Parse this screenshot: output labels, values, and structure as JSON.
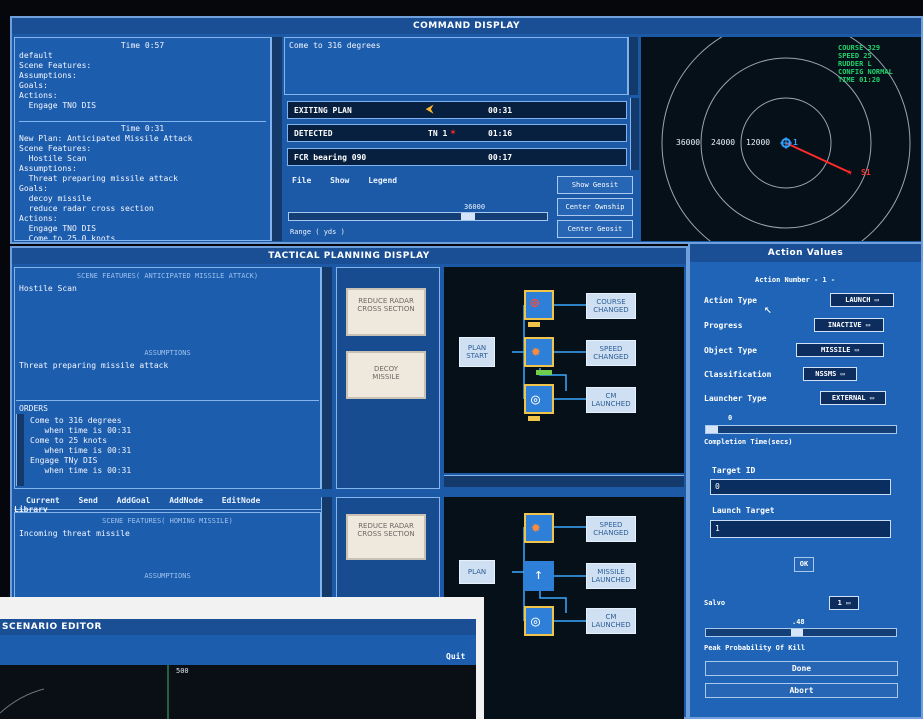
{
  "command_display": {
    "title": "COMMAND DISPLAY",
    "log": [
      {
        "text": "Time 0:57",
        "center": true
      },
      {
        "text": "default"
      },
      {
        "text": "Scene Features:"
      },
      {
        "text": "Assumptions:"
      },
      {
        "text": "Goals:"
      },
      {
        "text": "Actions:"
      },
      {
        "text": "  Engage TNO DIS"
      },
      {
        "text": "Time 0:31",
        "center": true
      },
      {
        "text": "New Plan: Anticipated Missile Attack"
      },
      {
        "text": "Scene Features:"
      },
      {
        "text": "  Hostile Scan"
      },
      {
        "text": "Assumptions:"
      },
      {
        "text": "  Threat preparing missile attack"
      },
      {
        "text": "Goals:"
      },
      {
        "text": "  decoy missile"
      },
      {
        "text": "  reduce radar cross section"
      },
      {
        "text": "Actions:"
      },
      {
        "text": "  Engage TNO DIS"
      },
      {
        "text": "  Come to 25.0 knots"
      }
    ],
    "order": "Come to 316 degrees",
    "events": [
      {
        "label": "EXITING PLAN",
        "track": "",
        "time": "00:31"
      },
      {
        "label": "DETECTED",
        "track": "TN 1",
        "time": "01:16"
      },
      {
        "label": "FCR bearing 090",
        "track": "",
        "time": "00:17"
      }
    ],
    "menu": [
      "File",
      "Show",
      "Legend"
    ],
    "range_value": "36000",
    "range_label": "Range ( yds )",
    "buttons": [
      "Show Geosit",
      "Center Ownship",
      "Center Geosit"
    ],
    "radar": {
      "rings": [
        "36000",
        "24000",
        "12000"
      ],
      "ownship": "1",
      "contact": "S1",
      "status": [
        "COURSE 329",
        "SPEED 25",
        "RUDDER L",
        "CONFIG NORMAL",
        "TIME 01:20"
      ]
    }
  },
  "tactical": {
    "title": "TACTICAL PLANNING DISPLAY",
    "plan1": {
      "scene_heading": "SCENE FEATURES( ANTICIPATED MISSILE ATTACK)",
      "scene_text": "Hostile Scan",
      "assumptions_heading": "ASSUMPTIONS",
      "assumptions_text": "Threat preparing missile attack",
      "orders_heading": "ORDERS",
      "orders": [
        "Come to 316 degrees",
        "   when time is 00:31",
        "Come to 25 knots",
        "   when time is 00:31",
        "Engage TNy DIS",
        "   when time is 00:31"
      ],
      "goals": [
        "REDUCE RADAR CROSS SECTION",
        "DECOY MISSILE"
      ],
      "start_node": "PLAN START",
      "outcomes": [
        "COURSE CHANGED",
        "SPEED CHANGED",
        "CM LAUNCHED"
      ]
    },
    "menu": [
      "Current",
      "Send",
      "AddGoal",
      "AddNode",
      "EditNode",
      "Library"
    ],
    "plan2": {
      "scene_heading": "SCENE FEATURES( HOMING MISSILE)",
      "scene_text": "Incoming threat missile",
      "assumptions_heading": "ASSUMPTIONS",
      "goals": [
        "REDUCE RADAR CROSS SECTION"
      ],
      "start_node": "PLAN",
      "outcomes": [
        "SPEED CHANGED",
        "MISSILE LAUNCHED",
        "CM LAUNCHED"
      ]
    }
  },
  "action_values": {
    "title": "Action Values",
    "action_number": "Action Number - 1 -",
    "fields": [
      {
        "label": "Action Type",
        "value": "LAUNCH"
      },
      {
        "label": "Progress",
        "value": "INACTIVE"
      },
      {
        "label": "Object Type",
        "value": "MISSILE"
      },
      {
        "label": "Classification",
        "value": "NSSMS"
      },
      {
        "label": "Launcher Type",
        "value": "EXTERNAL"
      }
    ],
    "completion_value": "0",
    "completion_label": "Completion Time(secs)",
    "target_id_label": "Target ID",
    "target_id_value": "0",
    "launch_target_label": "Launch Target",
    "launch_target_value": "1",
    "ok": "OK",
    "salvo_label": "Salvo",
    "salvo_value": "1",
    "pk_value": ".48",
    "pk_label": "Peak Probability Of Kill",
    "done": "Done",
    "abort": "Abort",
    "slider_levels": {
      "completion": 0.0,
      "pk": 0.48
    }
  },
  "scenario_editor": {
    "title": "SCENARIO EDITOR",
    "quit": "Quit",
    "scale": "500"
  },
  "colors": {
    "panel": "#1c5aa8",
    "title": "#1b4f95",
    "radar_green": "#22d36c",
    "contact_red": "#ff2a2a"
  }
}
